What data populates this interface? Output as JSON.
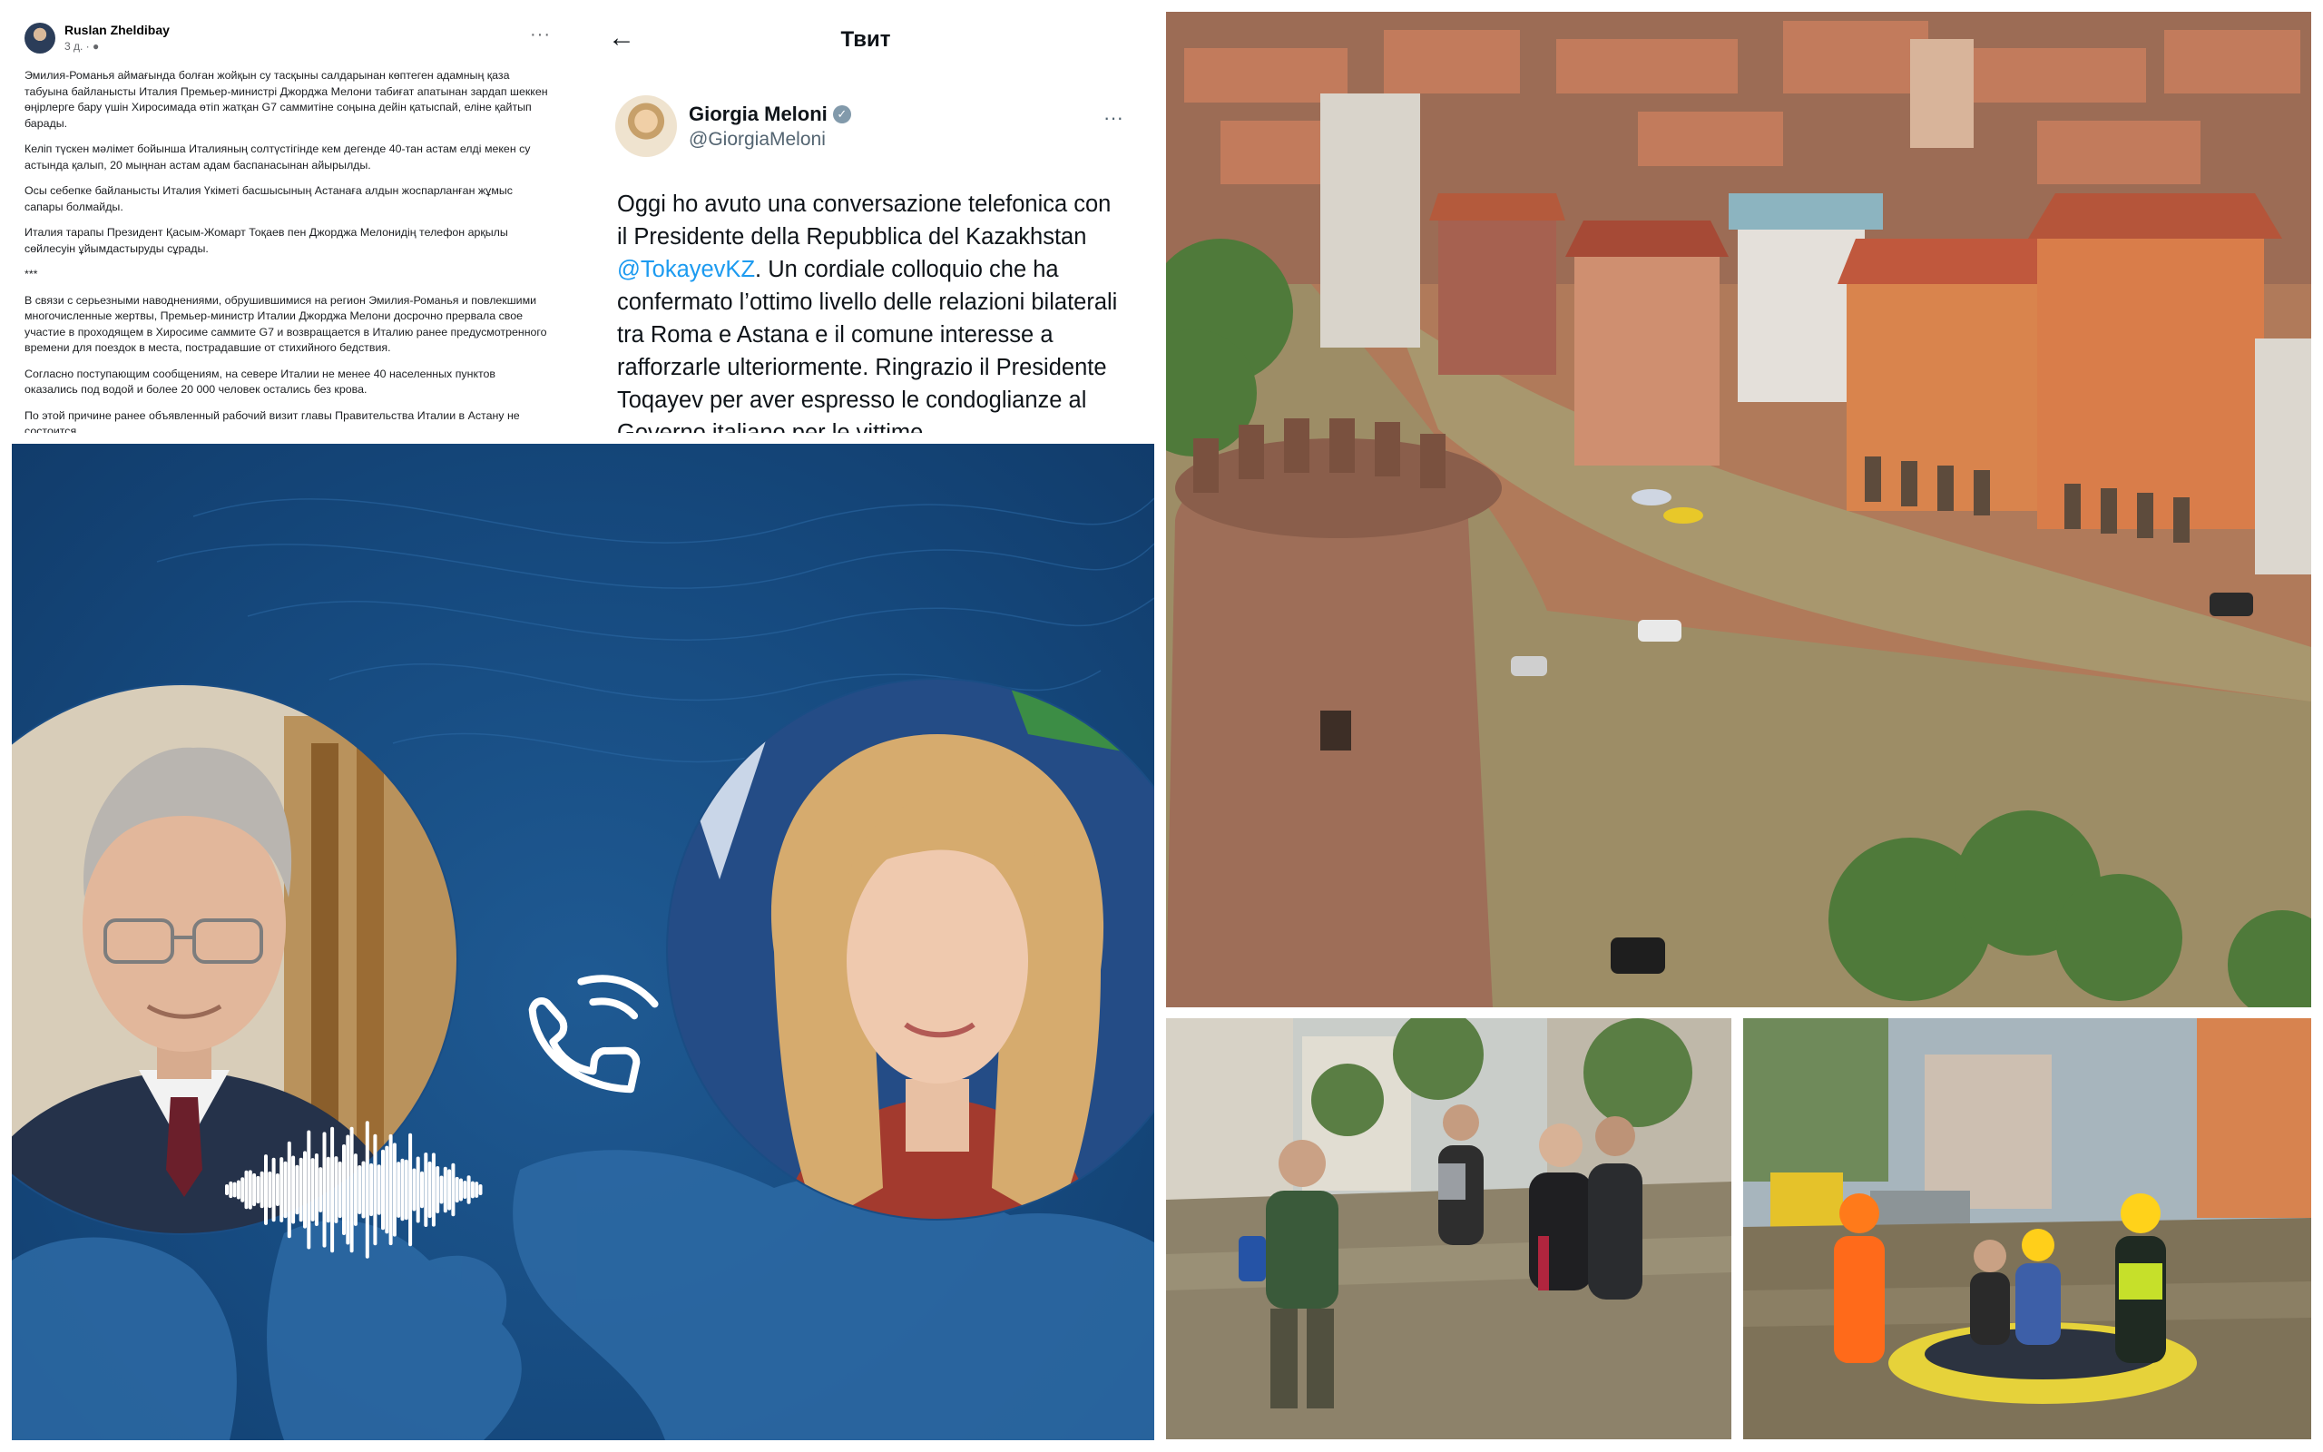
{
  "facebook_post": {
    "author": "Ruslan Zheldibay",
    "time": "3 д. · ",
    "more": "···",
    "paragraphs": [
      "Эмилия-Романья аймағында болған жойқын су тасқыны салдарынан көптеген адамның қаза табуына байланысты Италия Премьер-министрі Джорджа Мелони табиғат апатынан зардап шеккен өңірлерге бару үшін Хиросимада өтіп жатқан G7 саммитіне соңына дейін қатыспай, еліне қайтып барады.",
      "Келіп түскен мәлімет бойынша Италияның солтүстігінде кем дегенде 40-тан астам елді мекен су астында қалып, 20 мыңнан астам адам баспанасынан айырылды.",
      "Осы себепке байланысты Италия Үкіметі басшысының Астанаға алдын жоспарланған жұмыс сапары болмайды.",
      "Италия тарапы Президент Қасым-Жомарт Тоқаев пен Джорджа Мелонидің телефон арқылы сөйлесуін ұйымдастыруды сұрады.",
      "***",
      "В связи с серьезными наводнениями, обрушившимися на регион Эмилия-Романья и повлекшими многочисленные жертвы, Премьер-министр Италии Джорджа Мелони досрочно прервала свое участие в проходящем в Хиросиме саммите G7 и возвращается в Италию ранее предусмотренного времени для поездок в места, пострадавшие от стихийного бедствия.",
      "Согласно поступающим сообщениям, на севере Италии не менее 40 населенных пунктов оказались под водой и более 20 000 человек остались без крова.",
      "По этой причине ранее объявленный рабочий визит главы Правительства Италии в Астану не состоится."
    ]
  },
  "tweet": {
    "header_title": "Твит",
    "back_icon": "←",
    "name": "Giorgia Meloni",
    "verified": "✓",
    "handle": "@GiorgiaMeloni",
    "more": "···",
    "text_before": "Oggi ho avuto una conversazione telefonica con il Presidente della Repubblica del Kazakhstan ",
    "mention": "@TokayevKZ",
    "text_after": ". Un cordiale colloquio che ha confermato l’ottimo livello delle relazioni bilaterali tra Roma e Astana e il comune interesse a rafforzarle ulteriormente. Ringrazio il Presidente Toqayev per aver espresso le condoglianze al Governo italiano per le vittime"
  },
  "call_graphic": {
    "phone_icon": "phone-icon",
    "colors": {
      "background": "#164a7f",
      "map": "#2d6aa5",
      "waveform": "#ffffff"
    }
  },
  "colors": {
    "tweet_link": "#1d9bf0",
    "flood_water": "#9b8a63",
    "roof": "#b45a3c",
    "vest": "#ff6a1a"
  }
}
